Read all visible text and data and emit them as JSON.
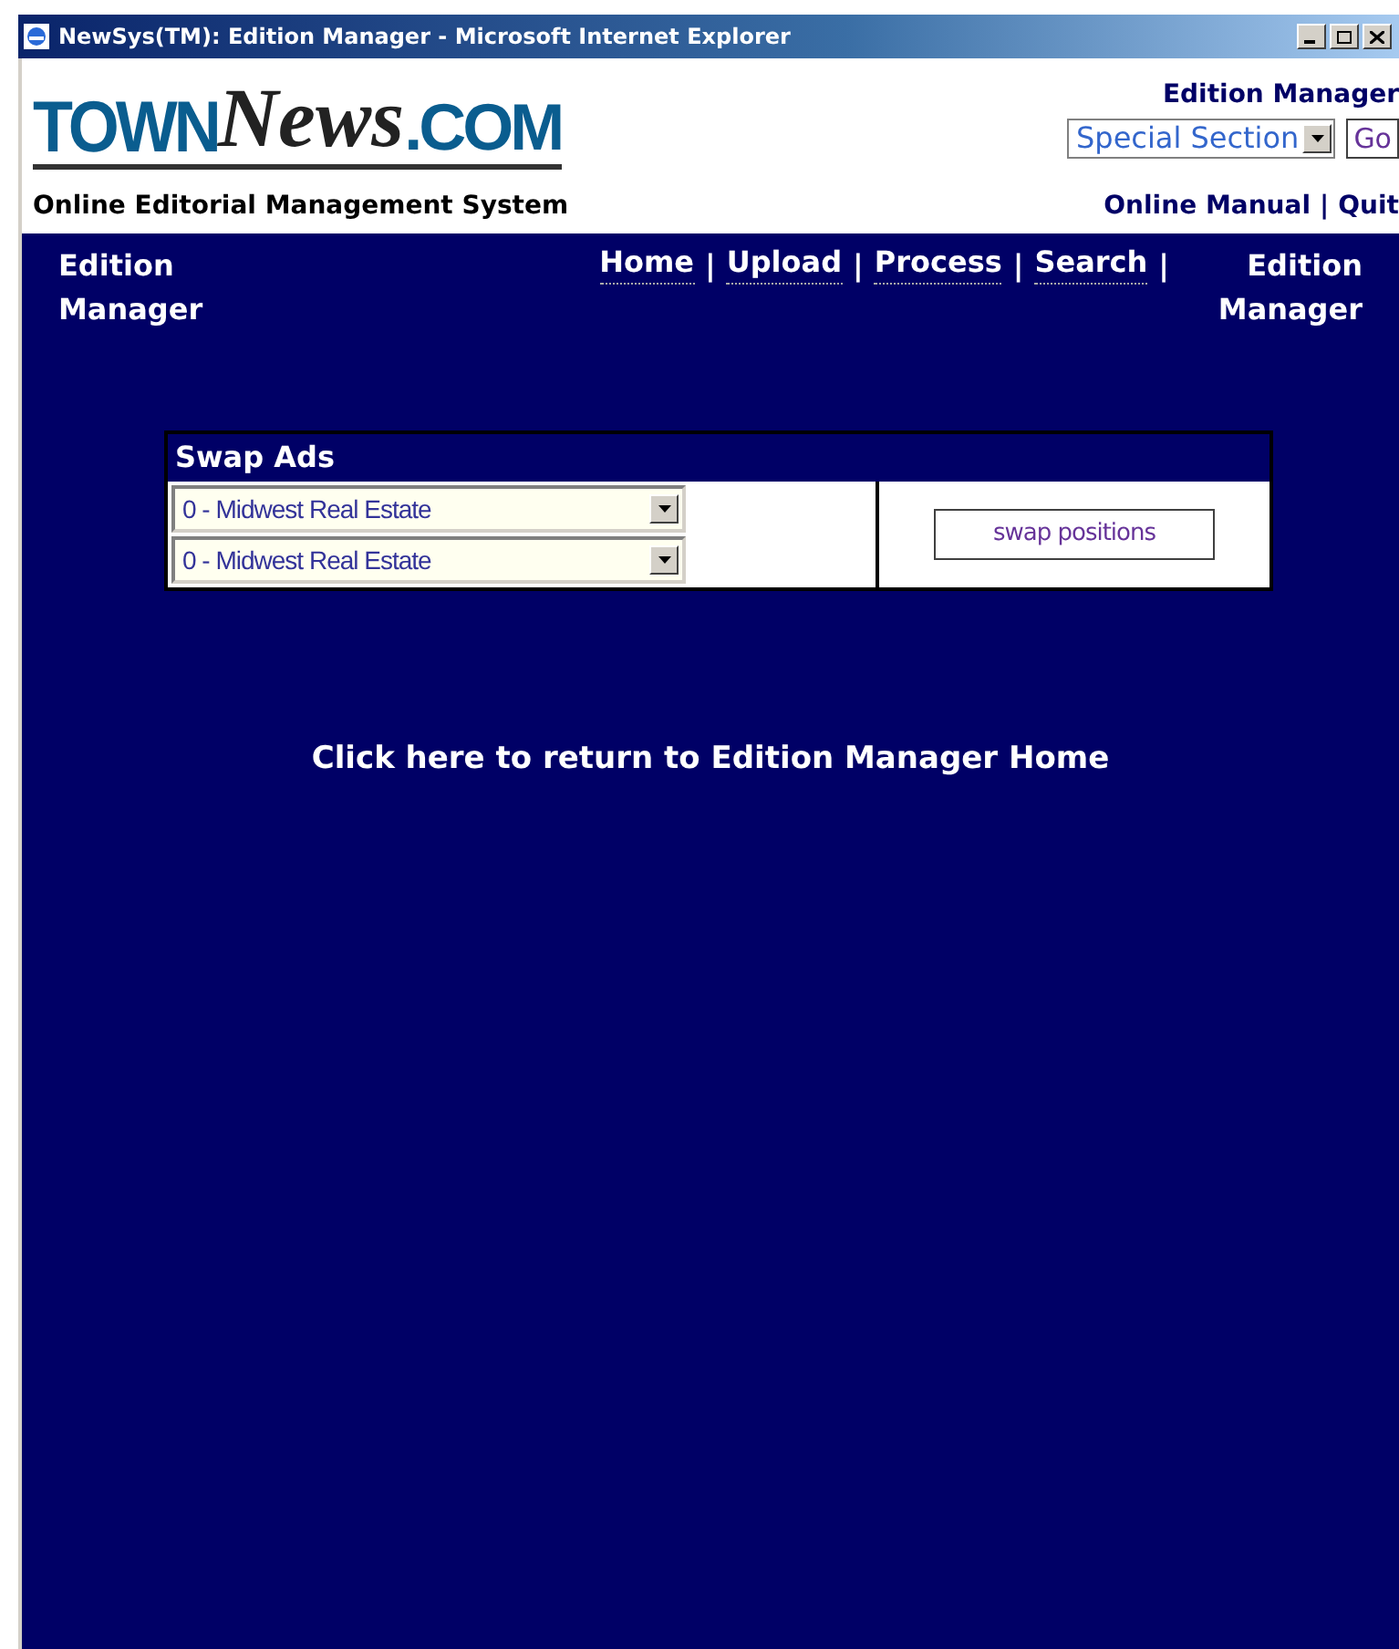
{
  "window": {
    "title": "NewSys(TM): Edition Manager - Microsoft Internet Explorer"
  },
  "logo": {
    "part_1": "TOWN",
    "part_2": "News",
    "part_3": ".COM"
  },
  "header": {
    "section_label": "Edition Manager",
    "section_select": {
      "value": "Special Section"
    },
    "go_button": "Go",
    "subtitle": "Online Editorial Management System",
    "links": [
      "Online Manual",
      "Quit"
    ],
    "separator": "|"
  },
  "nav": {
    "page_title": "Edition Manager",
    "links": [
      "Home",
      "Upload",
      "Process",
      "Search"
    ],
    "current": "Edition Manager",
    "separator": "|"
  },
  "swap_panel": {
    "title": "Swap Ads",
    "selects": [
      {
        "value": "0 - Midwest Real Estate"
      },
      {
        "value": "0 - Midwest Real Estate"
      }
    ],
    "button": "swap positions"
  },
  "return_link": "Click here to return to Edition Manager Home"
}
